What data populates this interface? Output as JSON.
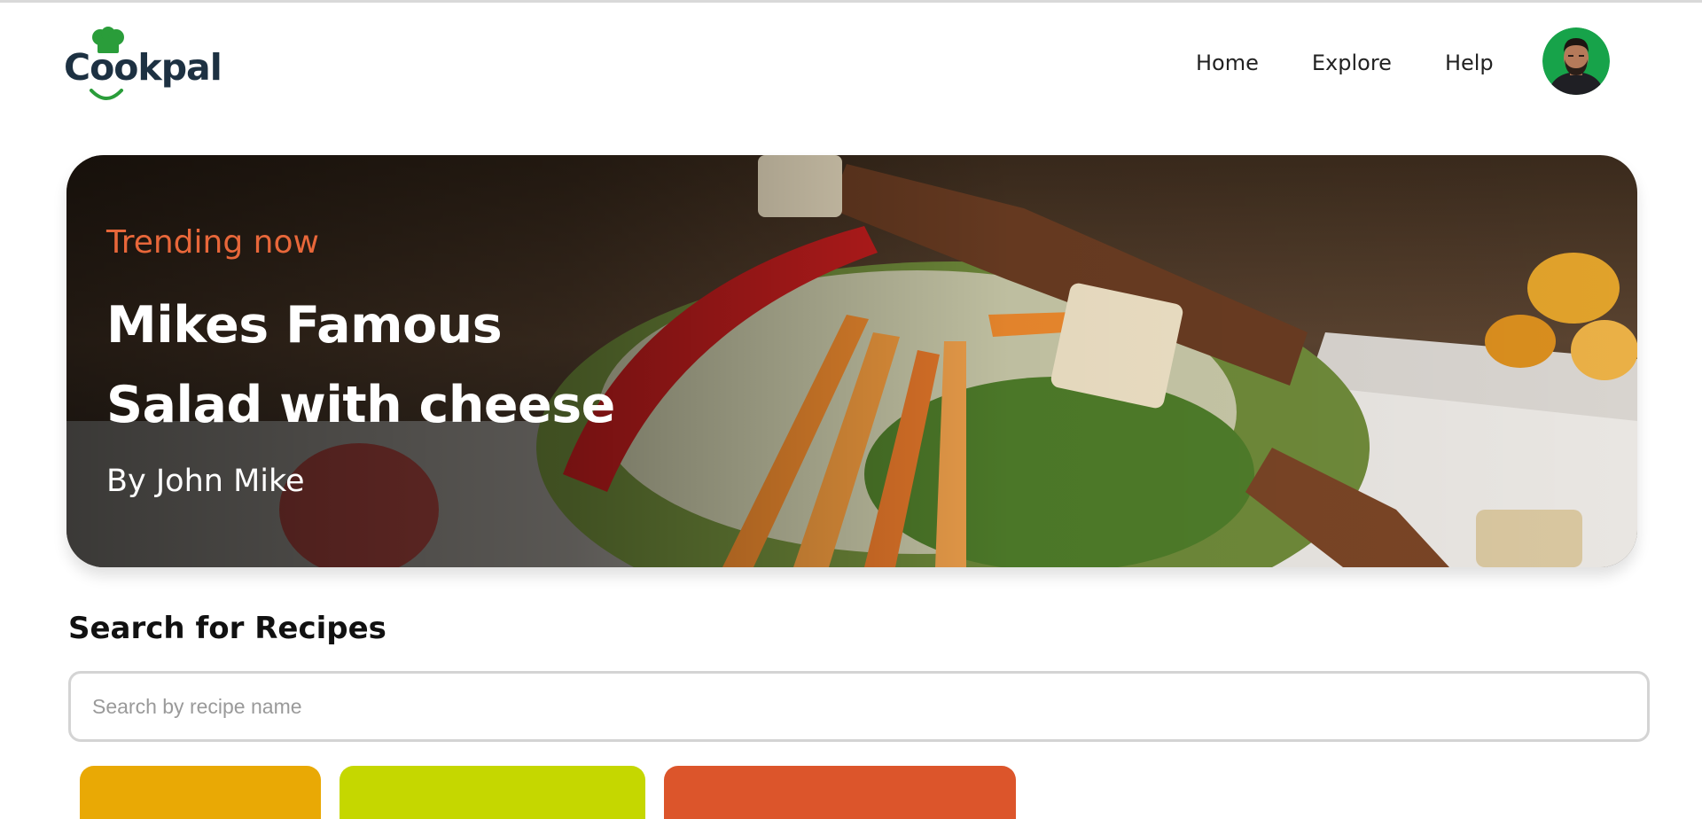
{
  "colors": {
    "brand_dark": "#1d3142",
    "brand_green": "#2a9d3a",
    "accent": "#e8673a",
    "tile_colors": [
      "#e9a905",
      "#c5d700",
      "#dc552b"
    ]
  },
  "header": {
    "logo_text": "Cookpal",
    "logo_icon": "chef-hat-icon",
    "nav": [
      {
        "label": "Home"
      },
      {
        "label": "Explore"
      },
      {
        "label": "Help"
      }
    ],
    "avatar_icon": "user-avatar"
  },
  "hero": {
    "kicker": "Trending now",
    "title_line1": "Mikes Famous",
    "title_line2": "Salad with cheese",
    "author": "By John Mike"
  },
  "search": {
    "title": "Search for Recipes",
    "placeholder": "Search by recipe name",
    "value": ""
  },
  "categories": [
    {
      "color": "#e9a905"
    },
    {
      "color": "#c5d700"
    },
    {
      "color": "#dc552b"
    }
  ]
}
